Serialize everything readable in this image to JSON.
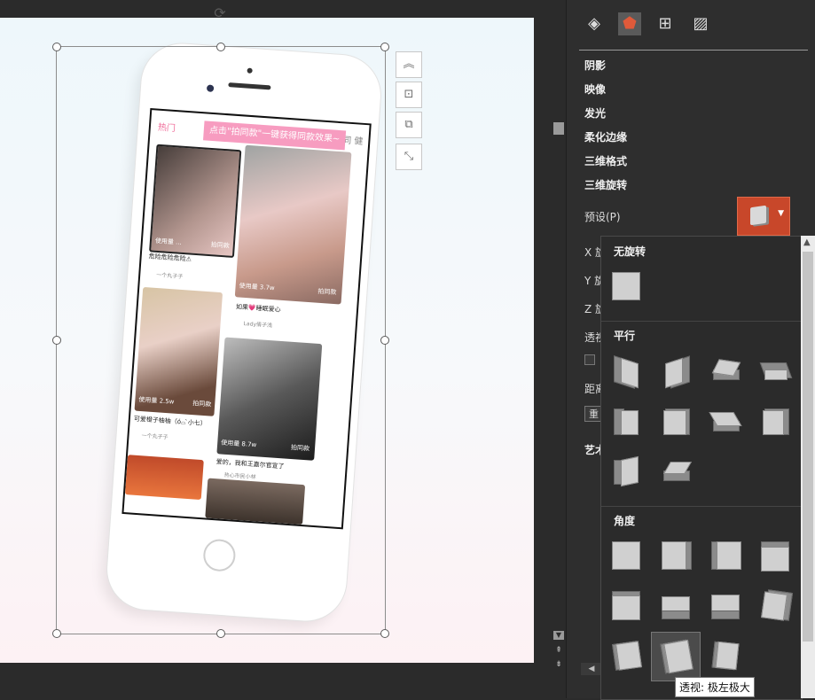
{
  "slide": {
    "app_banner": "点击\"拍同款\"一键获得同款效果~",
    "app_tab_left": "热门",
    "app_tab_right": "同 健",
    "cards": [
      {
        "tag": "使用量 ...",
        "btn": "拍同款",
        "caption": "危险危险危险⚠",
        "user": "一个丸子子"
      },
      {
        "tag": "使用量 3.7w",
        "btn": "拍同款",
        "caption": "如果💗睡眠爱心",
        "user": "Lady倩子浅"
      },
      {
        "tag": "使用量 2.5w",
        "btn": "拍同款",
        "caption": "可爱橙子柚柚（ó⌓ ̀小七）",
        "user": "一个丸子子"
      },
      {
        "tag": "使用量 8.7w",
        "btn": "拍同款",
        "caption": "爱的，我和王嘉尔官宣了",
        "user": "热心市民小林"
      },
      {
        "tag": "",
        "btn": "",
        "caption": "",
        "user": ""
      },
      {
        "tag": "",
        "btn": "",
        "caption": "",
        "user": ""
      }
    ]
  },
  "pane": {
    "tabs": [
      "fill-line",
      "effects",
      "size-properties",
      "picture"
    ],
    "sections": [
      "阴影",
      "映像",
      "发光",
      "柔化边缘",
      "三维格式",
      "三维旋转"
    ],
    "preset_label": "预设(P)",
    "rotation_labels": [
      "X 旋",
      "Y 旋",
      "Z 旋",
      "透视"
    ],
    "distance_label": "距离",
    "reset_stub": "重",
    "art_label": "艺术"
  },
  "gallery": {
    "groups": [
      {
        "title": "无旋转",
        "count": 1
      },
      {
        "title": "平行",
        "count": 10
      },
      {
        "title": "角度",
        "count": 11
      }
    ],
    "hovered_index": 9,
    "tooltip": "透视: 极左极大"
  },
  "colors": {
    "accent": "#c8472a",
    "pane_bg": "#2e2e2e"
  }
}
